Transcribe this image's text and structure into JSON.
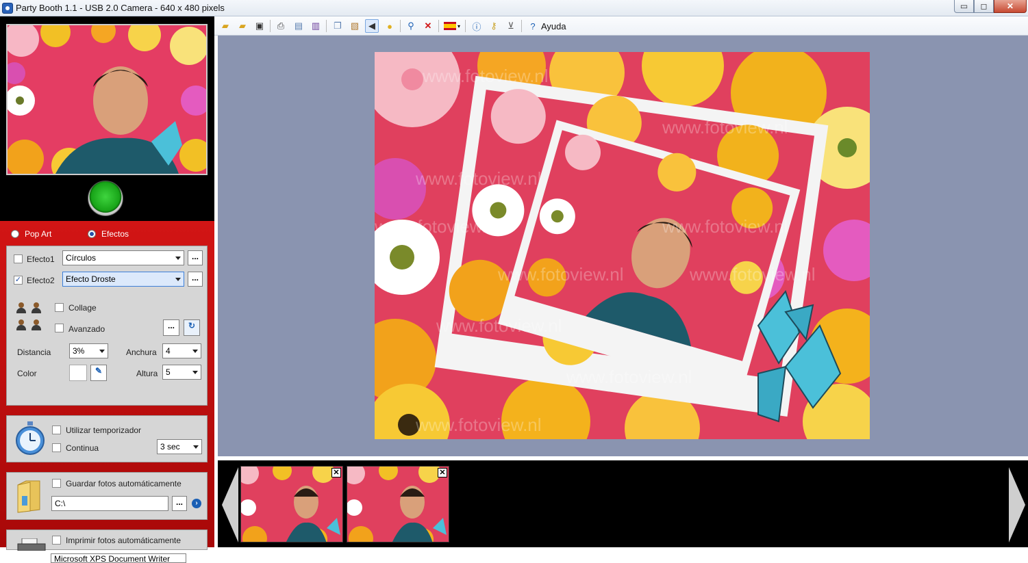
{
  "window": {
    "title": "Party Booth 1.1 - USB 2.0 Camera - 640 x 480 pixels",
    "controls": {
      "minimize": "▭",
      "maximize": "◻",
      "close": "✕"
    }
  },
  "toolbar": {
    "help_label": "Ayuda",
    "icons": [
      "open-folder-icon",
      "open-folder2-icon",
      "save-icon",
      "print-icon",
      "print-preview-icon",
      "film-icon",
      "copy-icon",
      "clipboard-icon",
      "sound-icon",
      "bulb-icon",
      "zoom-icon",
      "delete-icon",
      "language-flag-icon",
      "info-icon",
      "key-icon",
      "cart-icon",
      "help-icon"
    ]
  },
  "mode": {
    "options": [
      {
        "label": "Pop Art",
        "selected": false
      },
      {
        "label": "Efectos",
        "selected": true
      }
    ]
  },
  "effects": {
    "effect1": {
      "label": "Efecto1",
      "checked": false,
      "value": "Círculos",
      "more": "..."
    },
    "effect2": {
      "label": "Efecto2",
      "checked": true,
      "value": "Efecto Droste",
      "more": "..."
    },
    "collage": {
      "label": "Collage",
      "checked": false
    },
    "advanced": {
      "label": "Avanzado",
      "checked": false,
      "more": "..."
    },
    "distance": {
      "label": "Distancia",
      "value": "3%"
    },
    "width": {
      "label": "Anchura",
      "value": "4"
    },
    "color": {
      "label": "Color",
      "value": "#ffffff"
    },
    "height": {
      "label": "Altura",
      "value": "5"
    }
  },
  "timer": {
    "use_timer": {
      "label": "Utilizar temporizador",
      "checked": false
    },
    "continuous": {
      "label": "Continua",
      "checked": false
    },
    "interval": "3 sec"
  },
  "autosave": {
    "label": "Guardar fotos automáticamente",
    "checked": false,
    "path": "C:\\",
    "more": "..."
  },
  "autoprint": {
    "label": "Imprimir fotos automáticamente",
    "checked": false,
    "printer": "Microsoft XPS Document Writer"
  },
  "preview": {
    "watermark": "www.fotoview.nl"
  },
  "thumbnails": {
    "close_glyph": "✕",
    "count": 2
  },
  "colors": {
    "panel_red": "#c40f0f",
    "canvas_bg": "#8a94b0",
    "shoot_green": "#18a418"
  }
}
